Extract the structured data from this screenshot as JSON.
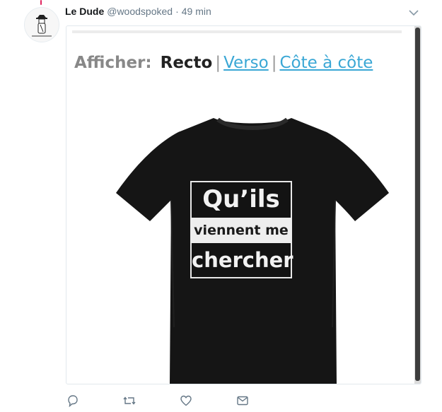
{
  "tweet": {
    "display_name": "Le Dude",
    "handle": "@woodspoked",
    "separator": "·",
    "time": "49 min"
  },
  "embed": {
    "show_label": "Afficher:",
    "options": [
      "Recto",
      "Verso",
      "Côte à côte"
    ],
    "selected": "Recto",
    "separator": "|"
  },
  "shirt_print": {
    "line1": "Qu’ils",
    "line2": "viennent me",
    "line3": "chercher"
  },
  "colors": {
    "link": "#3aa7d5",
    "handle_gray": "#657786",
    "thread_line": "#e0245e"
  },
  "actions": [
    "reply-icon",
    "retweet-icon",
    "like-icon",
    "message-icon"
  ]
}
